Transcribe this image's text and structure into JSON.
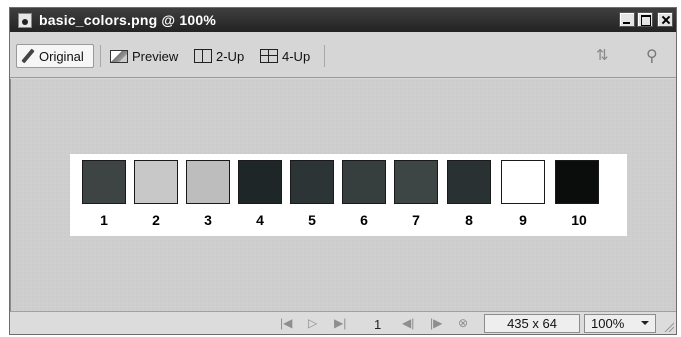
{
  "window": {
    "title": "basic_colors.png @ 100%"
  },
  "toolbar": {
    "tabs": [
      {
        "label": "Original",
        "icon": "pencil-icon",
        "active": true
      },
      {
        "label": "Preview",
        "icon": "preview-icon",
        "active": false
      },
      {
        "label": "2-Up",
        "icon": "two-up-icon",
        "active": false
      },
      {
        "label": "4-Up",
        "icon": "four-up-icon",
        "active": false
      }
    ]
  },
  "image": {
    "swatches": [
      {
        "label": "1",
        "color": "#3e4444"
      },
      {
        "label": "2",
        "color": "#c8c8c8"
      },
      {
        "label": "3",
        "color": "#bdbdbd"
      },
      {
        "label": "4",
        "color": "#1f2628"
      },
      {
        "label": "5",
        "color": "#2d3436"
      },
      {
        "label": "6",
        "color": "#363e3e"
      },
      {
        "label": "7",
        "color": "#3e4545"
      },
      {
        "label": "8",
        "color": "#2a3133"
      },
      {
        "label": "9",
        "color": "#ffffff"
      },
      {
        "label": "10",
        "color": "#0b0d0d"
      }
    ]
  },
  "statusbar": {
    "frame": "1",
    "dimensions": "435 x 64",
    "zoom": "100%"
  }
}
